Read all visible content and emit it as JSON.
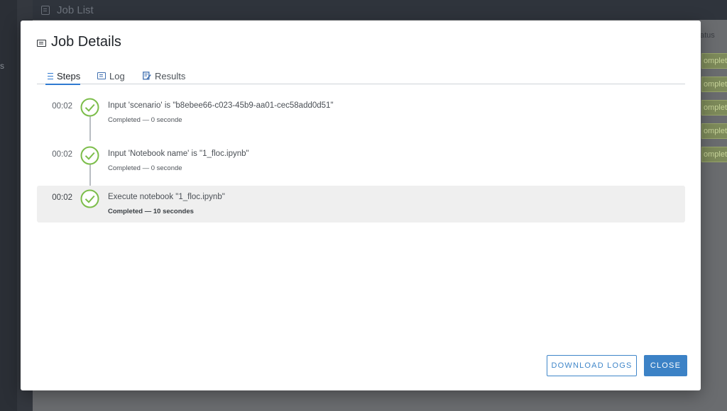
{
  "background": {
    "topbar_title": "Job List",
    "sidebar_fragment": "s",
    "status_column_header": "atus",
    "status_cells": [
      "omplet",
      "omplet",
      "omplet",
      "omplet",
      "omplet"
    ]
  },
  "modal": {
    "title": "Job Details",
    "icon": "document-icon",
    "tabs": [
      {
        "label": "Steps",
        "icon": "list-icon",
        "active": true
      },
      {
        "label": "Log",
        "icon": "log-icon",
        "active": false
      },
      {
        "label": "Results",
        "icon": "edit-results-icon",
        "active": false
      }
    ],
    "steps": [
      {
        "time": "00:02",
        "title": "Input 'scenario' is \"b8ebee66-c023-45b9-aa01-cec58add0d51\"",
        "status": "Completed — 0 seconde",
        "icon": "check-circle-icon",
        "highlighted": false
      },
      {
        "time": "00:02",
        "title": "Input 'Notebook name' is \"1_floc.ipynb\"",
        "status": "Completed — 0 seconde",
        "icon": "check-circle-icon",
        "highlighted": false
      },
      {
        "time": "00:02",
        "title": "Execute notebook \"1_floc.ipynb\"",
        "status": "Completed — 10 secondes",
        "icon": "check-circle-icon",
        "highlighted": true
      }
    ],
    "buttons": {
      "download_label": "DOWNLOAD LOGS",
      "close_label": "CLOSE"
    }
  },
  "colors": {
    "accent": "#2f7ad1",
    "success": "#7cbd4a",
    "highlight_row": "#efefef"
  }
}
